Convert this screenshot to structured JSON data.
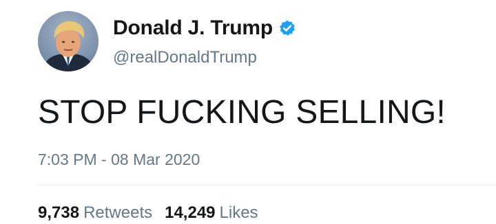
{
  "user": {
    "display_name": "Donald J. Trump",
    "handle": "@realDonaldTrump",
    "verified": true,
    "verified_icon": "verified-badge-icon"
  },
  "tweet": {
    "text": "STOP FUCKING SELLING!",
    "timestamp": "7:03 PM - 08 Mar 2020"
  },
  "stats": {
    "retweets_count": "9,738",
    "retweets_label": "Retweets",
    "likes_count": "14,249",
    "likes_label": "Likes"
  },
  "colors": {
    "text_primary": "#14171a",
    "text_secondary": "#657786",
    "verified_blue": "#1da1f2",
    "divider": "#e1e8ed"
  }
}
